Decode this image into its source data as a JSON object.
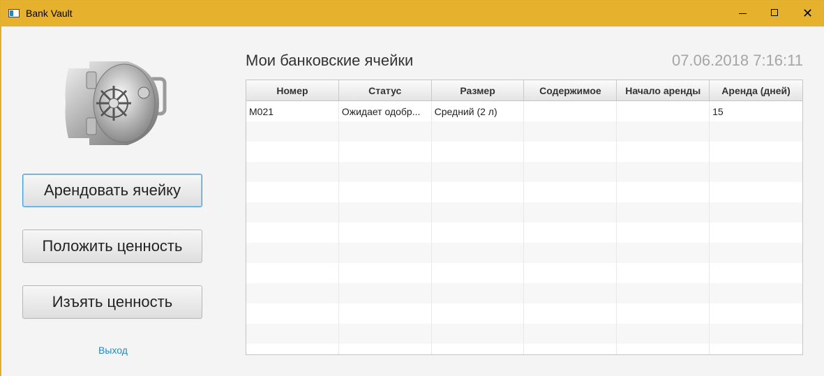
{
  "window": {
    "title": "Bank Vault",
    "accent_color": "#e6b22e",
    "icons": [
      "app-icon",
      "minimize-icon",
      "maximize-icon",
      "close-icon"
    ]
  },
  "sidebar": {
    "vault_icon": "vault-door-icon",
    "buttons": [
      {
        "label": "Арендовать ячейку"
      },
      {
        "label": "Положить ценность"
      },
      {
        "label": "Изъять ценность"
      }
    ],
    "exit_label": "Выход"
  },
  "main": {
    "title": "Мои банковские ячейки",
    "datetime": "07.06.2018 7:16:11",
    "table": {
      "columns": [
        "Номер",
        "Статус",
        "Размер",
        "Содержимое",
        "Начало аренды",
        "Аренда (дней)"
      ],
      "rows": [
        [
          "M021",
          "Ожидает одобр...",
          "Средний (2 л)",
          "",
          "",
          "15"
        ],
        [
          "",
          "",
          "",
          "",
          "",
          ""
        ],
        [
          "",
          "",
          "",
          "",
          "",
          ""
        ],
        [
          "",
          "",
          "",
          "",
          "",
          ""
        ],
        [
          "",
          "",
          "",
          "",
          "",
          ""
        ],
        [
          "",
          "",
          "",
          "",
          "",
          ""
        ],
        [
          "",
          "",
          "",
          "",
          "",
          ""
        ],
        [
          "",
          "",
          "",
          "",
          "",
          ""
        ],
        [
          "",
          "",
          "",
          "",
          "",
          ""
        ],
        [
          "",
          "",
          "",
          "",
          "",
          ""
        ],
        [
          "",
          "",
          "",
          "",
          "",
          ""
        ],
        [
          "",
          "",
          "",
          "",
          "",
          ""
        ],
        [
          "",
          "",
          "",
          "",
          "",
          ""
        ]
      ]
    }
  }
}
